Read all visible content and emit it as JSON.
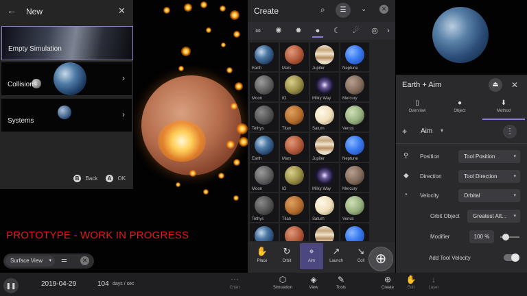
{
  "new_panel": {
    "title": "New",
    "cards": [
      {
        "label": "Empty Simulation"
      },
      {
        "label": "Collisions"
      },
      {
        "label": "Systems"
      }
    ],
    "footer": {
      "back_key": "B",
      "back_label": "Back",
      "ok_key": "A",
      "ok_label": "OK"
    }
  },
  "banner": "PROTOTYPE - WORK IN PROGRESS",
  "surface_view": {
    "selected": "Surface View"
  },
  "create_panel": {
    "title": "Create",
    "bodies": [
      "Earth",
      "Mars",
      "Jupiter",
      "Neptune",
      "Moon",
      "IO",
      "Milky Way",
      "Mercury",
      "Tethys",
      "Titan",
      "Saturn",
      "Venus",
      "Earth",
      "Mars",
      "Jupiter",
      "Neptune",
      "Moon",
      "IO",
      "Milky Way",
      "Mercury",
      "Tethys",
      "Titan",
      "Saturn",
      "Venus",
      "",
      "",
      "",
      ""
    ],
    "tools": [
      "Place",
      "Orbit",
      "Aim",
      "Launch",
      "Coll"
    ],
    "active_tool": "Aim"
  },
  "right_panel": {
    "title": "Earth + Aim",
    "tabs": [
      "Overview",
      "Object",
      "Method"
    ],
    "active_tab": "Method",
    "mode": "Aim",
    "rows": [
      {
        "label": "Position",
        "value": "Tool Position"
      },
      {
        "label": "Direction",
        "value": "Tool Direction"
      },
      {
        "label": "Velocity",
        "value": "Orbital"
      },
      {
        "label": "Orbit Object",
        "value": "Greatest Att..."
      },
      {
        "label": "Modifier",
        "value": "100 %"
      },
      {
        "label": "Add Tool Velocity",
        "value": ""
      }
    ],
    "modifier_fraction": 0.3,
    "add_tool_velocity": true
  },
  "bottom_bar": {
    "date": "2019-04-29",
    "speed": "104",
    "speed_unit": "days / sec",
    "items": [
      "Chart",
      "Simulation",
      "View",
      "Tools",
      "Create",
      "Edit",
      "Laser"
    ]
  },
  "colors": {
    "accent": "#8b7fe0",
    "banner": "#e21b1b",
    "panel": "#262629"
  }
}
